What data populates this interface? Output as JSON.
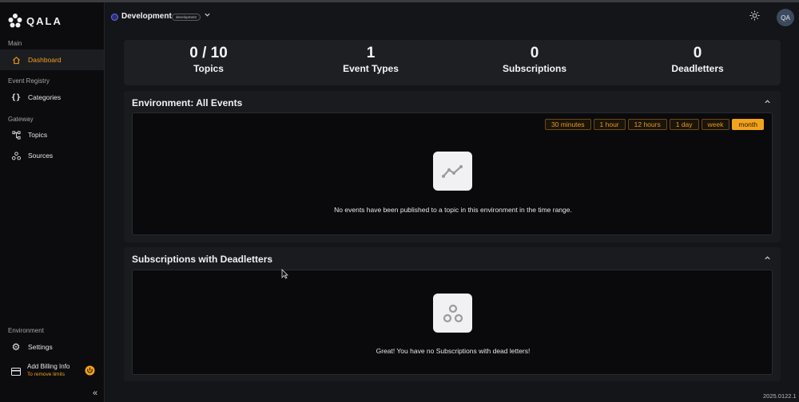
{
  "app": {
    "logo_text": "QALA"
  },
  "sidebar": {
    "sections": {
      "main": "Main",
      "event_registry": "Event Registry",
      "gateway": "Gateway",
      "environment": "Environment"
    },
    "items": {
      "dashboard": "Dashboard",
      "categories": "Categories",
      "topics": "Topics",
      "sources": "Sources",
      "settings": "Settings"
    },
    "billing": {
      "title": "Add Billing Info",
      "subtitle": "To remove limits"
    },
    "collapse_icon": "double-chevron-left-icon"
  },
  "header": {
    "env_name": "Development",
    "env_badge": "development",
    "avatar": "QA",
    "theme_icon": "sun-icon"
  },
  "stats": [
    {
      "value": "0 / 10",
      "label": "Topics"
    },
    {
      "value": "1",
      "label": "Event Types"
    },
    {
      "value": "0",
      "label": "Subscriptions"
    },
    {
      "value": "0",
      "label": "Deadletters"
    }
  ],
  "events_panel": {
    "title": "Environment: All Events",
    "ranges": [
      "30 minutes",
      "1 hour",
      "12 hours",
      "1 day",
      "week",
      "month"
    ],
    "selected_range": "month",
    "empty_message": "No events have been published to a topic in this environment in the time range."
  },
  "deadletters_panel": {
    "title": "Subscriptions with Deadletters",
    "empty_message": "Great! You have no Subscriptions with dead letters!"
  },
  "footer": {
    "version": "2025.0122.1"
  },
  "colors": {
    "accent": "#f2a31c",
    "background": "#141518",
    "sidebar": "#0c0c0e"
  }
}
